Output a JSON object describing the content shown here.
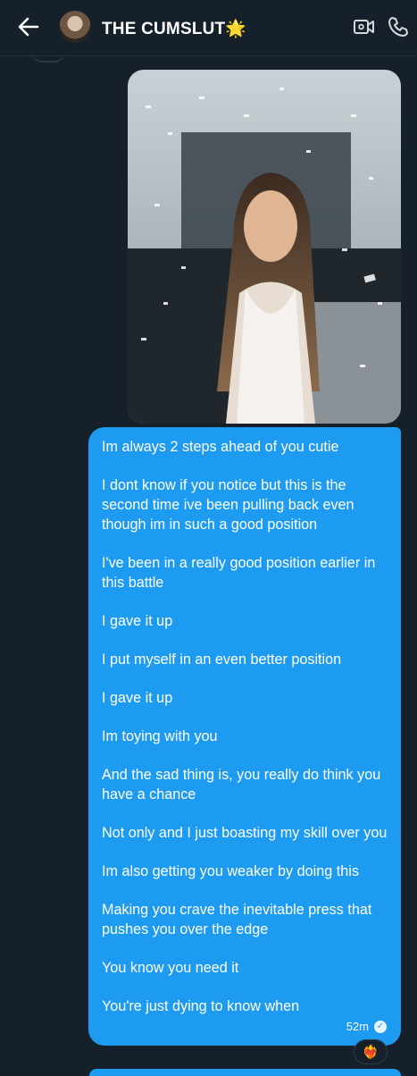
{
  "header": {
    "title": "THE CUMSLUT",
    "title_emoji": "🌟",
    "icons": [
      "back-arrow-icon",
      "avatar",
      "video-icon",
      "phone-icon"
    ]
  },
  "message_image": {
    "description_icon": "photo"
  },
  "message": {
    "lines": [
      "Im always 2 steps ahead of you cutie",
      "I dont know if you notice but this is the second time ive been pulling back even though im in such a good position",
      "I've been in a really good position earlier in this battle",
      "I gave it up",
      "I put myself in an even better position",
      "I gave it up",
      "Im toying with you",
      "And the sad thing is, you really do think you have a chance",
      "Not only and I just boasting my skill over you",
      "Im also getting you weaker by doing this",
      "Making you crave the inevitable press that pushes you over the edge",
      "You know you need it",
      "You're just dying to know when"
    ],
    "time": "52m",
    "status_icon": "check-icon",
    "reaction": "❤️‍🔥"
  },
  "colors": {
    "background": "#15202b",
    "bubble": "#1d9bf0",
    "text": "#ffffff"
  }
}
